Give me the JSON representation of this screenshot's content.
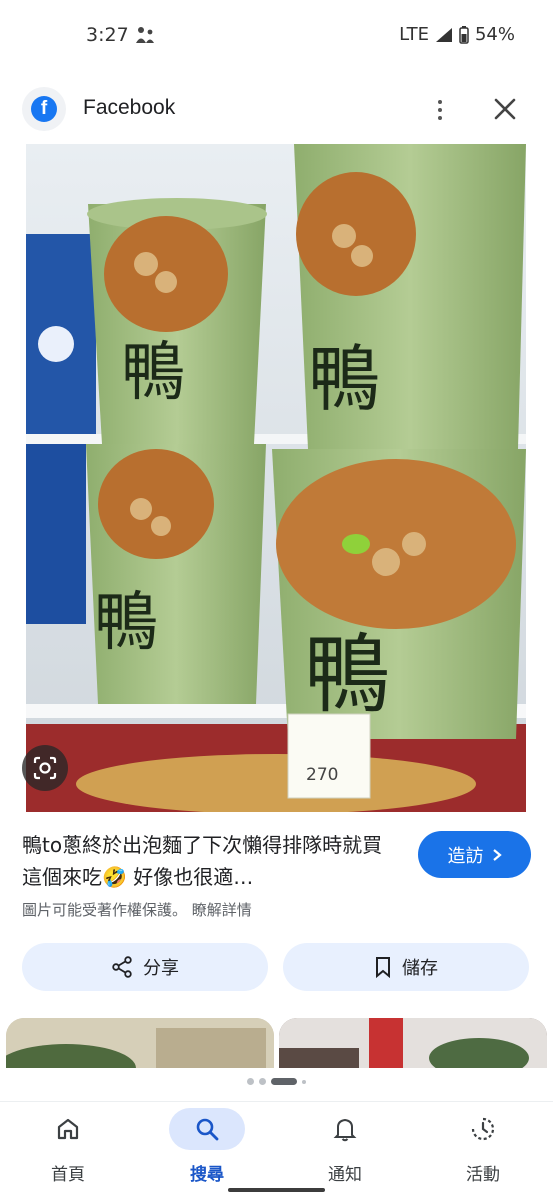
{
  "status_bar": {
    "time": "3:27",
    "network": "LTE",
    "battery": "54%"
  },
  "header": {
    "title": "Facebook",
    "logo_letter": "f",
    "icons": [
      "facebook-logo-icon",
      "more-vert-icon",
      "close-icon"
    ]
  },
  "image": {
    "description_icons": [
      "lens-icon"
    ]
  },
  "caption": {
    "text": "鴨to蔥終於出泡麵了下次懶得排隊時就買這個來吃🤣 好像也很適…",
    "visit_label": "造訪",
    "copyright_text": "圖片可能受著作權保護。 瞭解詳情"
  },
  "actions": {
    "share_label": "分享",
    "save_label": "儲存"
  },
  "bottom_nav": {
    "items": [
      {
        "label": "首頁",
        "icon": "home-icon",
        "active": false
      },
      {
        "label": "搜尋",
        "icon": "search-icon",
        "active": true
      },
      {
        "label": "通知",
        "icon": "bell-icon",
        "active": false
      },
      {
        "label": "活動",
        "icon": "history-icon",
        "active": false
      }
    ]
  },
  "colors": {
    "accent": "#1a73e8",
    "fb_blue": "#1877f2",
    "button_bg": "#e8f0fe",
    "nav_active_bg": "#dbe6fd"
  }
}
